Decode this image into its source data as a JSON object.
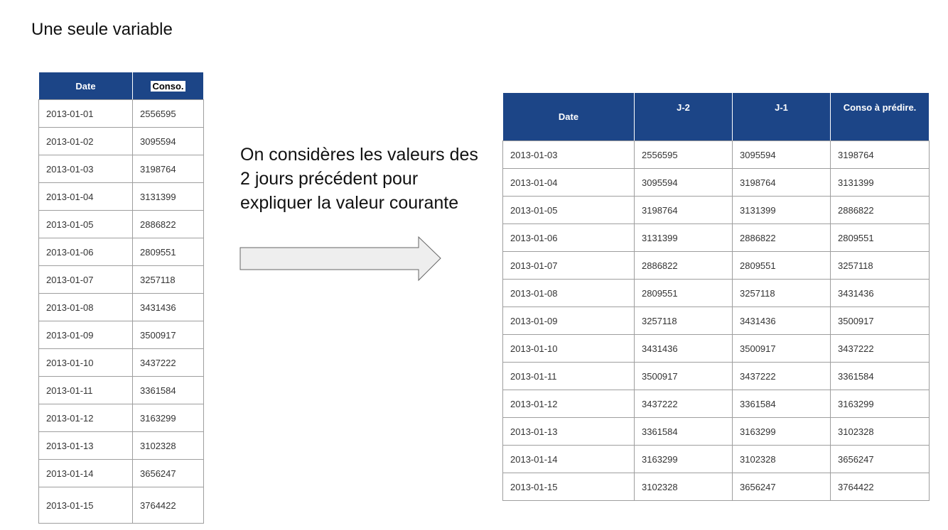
{
  "title": "Une seule variable",
  "explanation": "On considères les valeurs des 2 jours précédent pour expliquer la valeur courante",
  "arrow_icon": "right-arrow-icon",
  "colors": {
    "header_bg": "#1c4587",
    "header_text": "#ffffff",
    "border": "#9e9e9e",
    "arrow_fill": "#eeeeee"
  },
  "left_table": {
    "headers": [
      "Date",
      "Conso."
    ],
    "rows": [
      [
        "2013-01-01",
        "2556595"
      ],
      [
        "2013-01-02",
        "3095594"
      ],
      [
        "2013-01-03",
        "3198764"
      ],
      [
        "2013-01-04",
        "3131399"
      ],
      [
        "2013-01-05",
        "2886822"
      ],
      [
        "2013-01-06",
        "2809551"
      ],
      [
        "2013-01-07",
        "3257118"
      ],
      [
        "2013-01-08",
        "3431436"
      ],
      [
        "2013-01-09",
        "3500917"
      ],
      [
        "2013-01-10",
        "3437222"
      ],
      [
        "2013-01-11",
        "3361584"
      ],
      [
        "2013-01-12",
        "3163299"
      ],
      [
        "2013-01-13",
        "3102328"
      ],
      [
        "2013-01-14",
        "3656247"
      ],
      [
        "2013-01-15",
        "3764422"
      ]
    ]
  },
  "right_table": {
    "headers": [
      "Date",
      "J-2",
      "J-1",
      "Conso à prédire."
    ],
    "rows": [
      [
        "2013-01-03",
        "2556595",
        "3095594",
        "3198764"
      ],
      [
        "2013-01-04",
        "3095594",
        "3198764",
        "3131399"
      ],
      [
        "2013-01-05",
        "3198764",
        "3131399",
        "2886822"
      ],
      [
        "2013-01-06",
        "3131399",
        "2886822",
        "2809551"
      ],
      [
        "2013-01-07",
        "2886822",
        "2809551",
        "3257118"
      ],
      [
        "2013-01-08",
        "2809551",
        "3257118",
        "3431436"
      ],
      [
        "2013-01-09",
        "3257118",
        "3431436",
        "3500917"
      ],
      [
        "2013-01-10",
        "3431436",
        "3500917",
        "3437222"
      ],
      [
        "2013-01-11",
        "3500917",
        "3437222",
        "3361584"
      ],
      [
        "2013-01-12",
        "3437222",
        "3361584",
        "3163299"
      ],
      [
        "2013-01-13",
        "3361584",
        "3163299",
        "3102328"
      ],
      [
        "2013-01-14",
        "3163299",
        "3102328",
        "3656247"
      ],
      [
        "2013-01-15",
        "3102328",
        "3656247",
        "3764422"
      ]
    ]
  }
}
